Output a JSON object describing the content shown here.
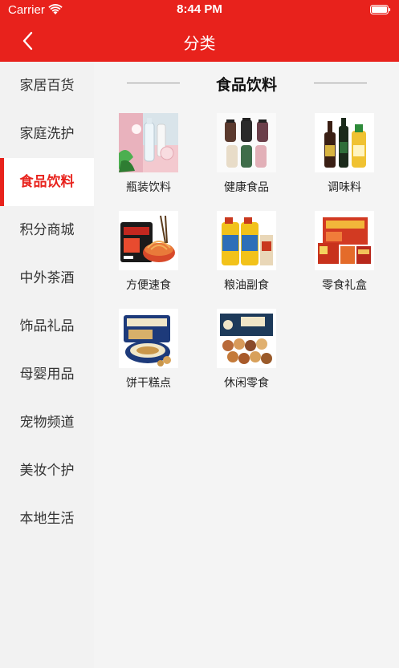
{
  "status_bar": {
    "carrier": "Carrier",
    "time": "8:44 PM"
  },
  "nav": {
    "title": "分类"
  },
  "sidebar": {
    "items": [
      {
        "label": "家居百货"
      },
      {
        "label": "家庭洗护"
      },
      {
        "label": "食品饮料",
        "active": true
      },
      {
        "label": "积分商城"
      },
      {
        "label": "中外茶酒"
      },
      {
        "label": "饰品礼品"
      },
      {
        "label": "母婴用品"
      },
      {
        "label": "宠物频道"
      },
      {
        "label": "美妆个护"
      },
      {
        "label": "本地生活"
      }
    ]
  },
  "section": {
    "title": "食品饮料",
    "items": [
      {
        "label": "瓶装饮料",
        "image": "bottled-drinks-image"
      },
      {
        "label": "健康食品",
        "image": "health-food-image"
      },
      {
        "label": "调味料",
        "image": "seasoning-image"
      },
      {
        "label": "方便速食",
        "image": "instant-food-image"
      },
      {
        "label": "粮油副食",
        "image": "grain-oil-image"
      },
      {
        "label": "零食礼盒",
        "image": "snack-gift-box-image"
      },
      {
        "label": "饼干糕点",
        "image": "biscuits-pastry-image"
      },
      {
        "label": "休闲零食",
        "image": "leisure-snacks-image"
      }
    ]
  },
  "colors": {
    "brand_red": "#e8221c",
    "sidebar_bg": "#f2f2f2",
    "content_bg": "#f4f4f4"
  }
}
